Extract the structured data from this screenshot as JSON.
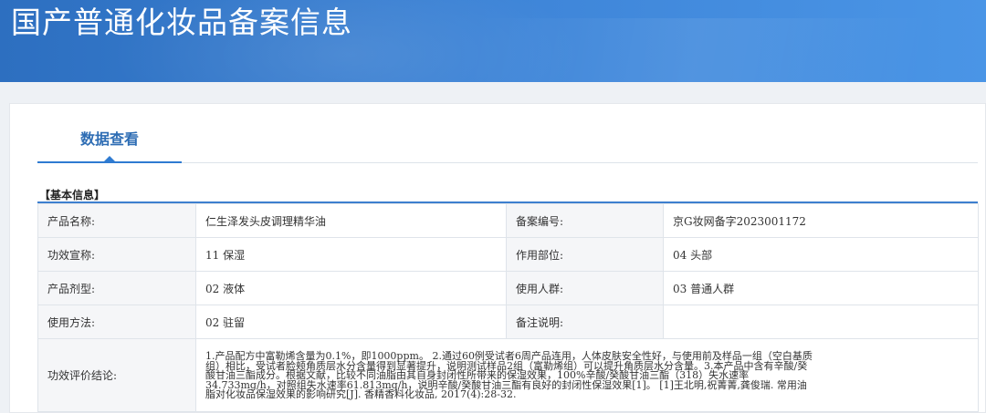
{
  "header": {
    "title": "国产普通化妆品备案信息"
  },
  "tabs": [
    {
      "label": "数据查看"
    }
  ],
  "section": {
    "title": "【基本信息】"
  },
  "info": {
    "product_name_label": "产品名称:",
    "product_name": "仁生泽发头皮调理精华油",
    "record_no_label": "备案编号:",
    "record_no": "京G妆网备字2023001172",
    "efficacy_label": "功效宣称:",
    "efficacy": "11 保湿",
    "body_part_label": "作用部位:",
    "body_part": "04 头部",
    "dosage_form_label": "产品剂型:",
    "dosage_form": "02 液体",
    "user_group_label": "使用人群:",
    "user_group": "03 普通人群",
    "usage_label": "使用方法:",
    "usage": "02 驻留",
    "remark_label": "备注说明:",
    "remark": "",
    "conclusion_label": "功效评价结论:",
    "conclusion": "1.产品配方中富勒烯含量为0.1%，即1000ppm。 2.通过60例受试者6周产品连用，人体皮肤安全性好，与使用前及样品一组（空白基质组）相比，受试者脸颊角质层水分含量得到显著提升，说明测试样品2组（富勒烯组）可以提升角质层水分含量。3.本产品中含有辛酸/癸酸甘油三酯成分。根据文献，比较不同油脂由其自身封闭性所带来的保湿效果，100%辛酸/癸酸甘油三酯（318）失水速率34.733mg/h，对照组失水速率61.813mg/h，说明辛酸/癸酸甘油三酯有良好的封闭性保湿效果[1]。 [1]王北明,祝菁菁,龚俊瑞. 常用油脂对化妆品保湿效果的影响研究[J]. 香精香料化妆品, 2017(4):28-32."
  }
}
